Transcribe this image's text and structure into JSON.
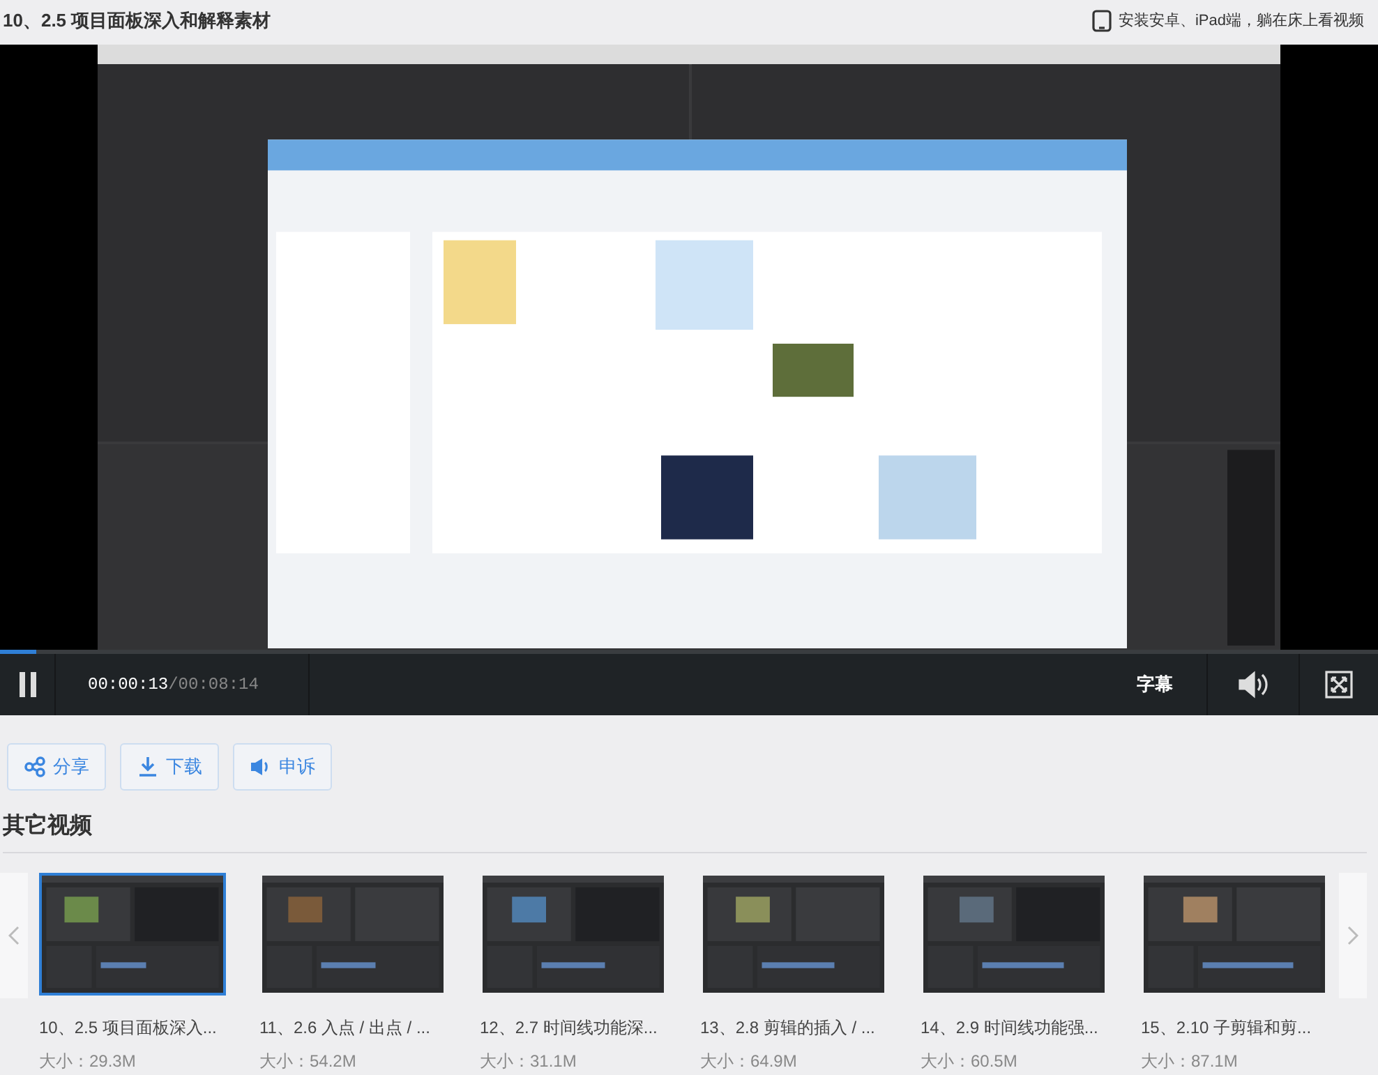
{
  "title": "10、2.5 项目面板深入和解释素材",
  "app_promo": "安装安卓、iPad端，躺在床上看视频",
  "player": {
    "progress": {
      "level": 0.026
    },
    "playing": true,
    "current_time": "00:00:13",
    "duration": "/00:08:14",
    "subtitle_button": "字幕"
  },
  "actions": [
    {
      "kind": "share",
      "label": "分享"
    },
    {
      "kind": "download",
      "label": "下载"
    },
    {
      "kind": "report",
      "label": "申诉"
    }
  ],
  "other_videos": {
    "heading": "其它视频",
    "items": [
      {
        "title": "10、2.5 项目面板深入...",
        "size": "大小：29.3M",
        "selected": true
      },
      {
        "title": "11、2.6 入点 / 出点 / ...",
        "size": "大小：54.2M",
        "selected": false
      },
      {
        "title": "12、2.7 时间线功能深...",
        "size": "大小：31.1M",
        "selected": false
      },
      {
        "title": "13、2.8 剪辑的插入 / ...",
        "size": "大小：64.9M",
        "selected": false
      },
      {
        "title": "14、2.9 时间线功能强...",
        "size": "大小：60.5M",
        "selected": false
      },
      {
        "title": "15、2.10 子剪辑和剪...",
        "size": "大小：87.1M",
        "selected": false
      }
    ]
  }
}
